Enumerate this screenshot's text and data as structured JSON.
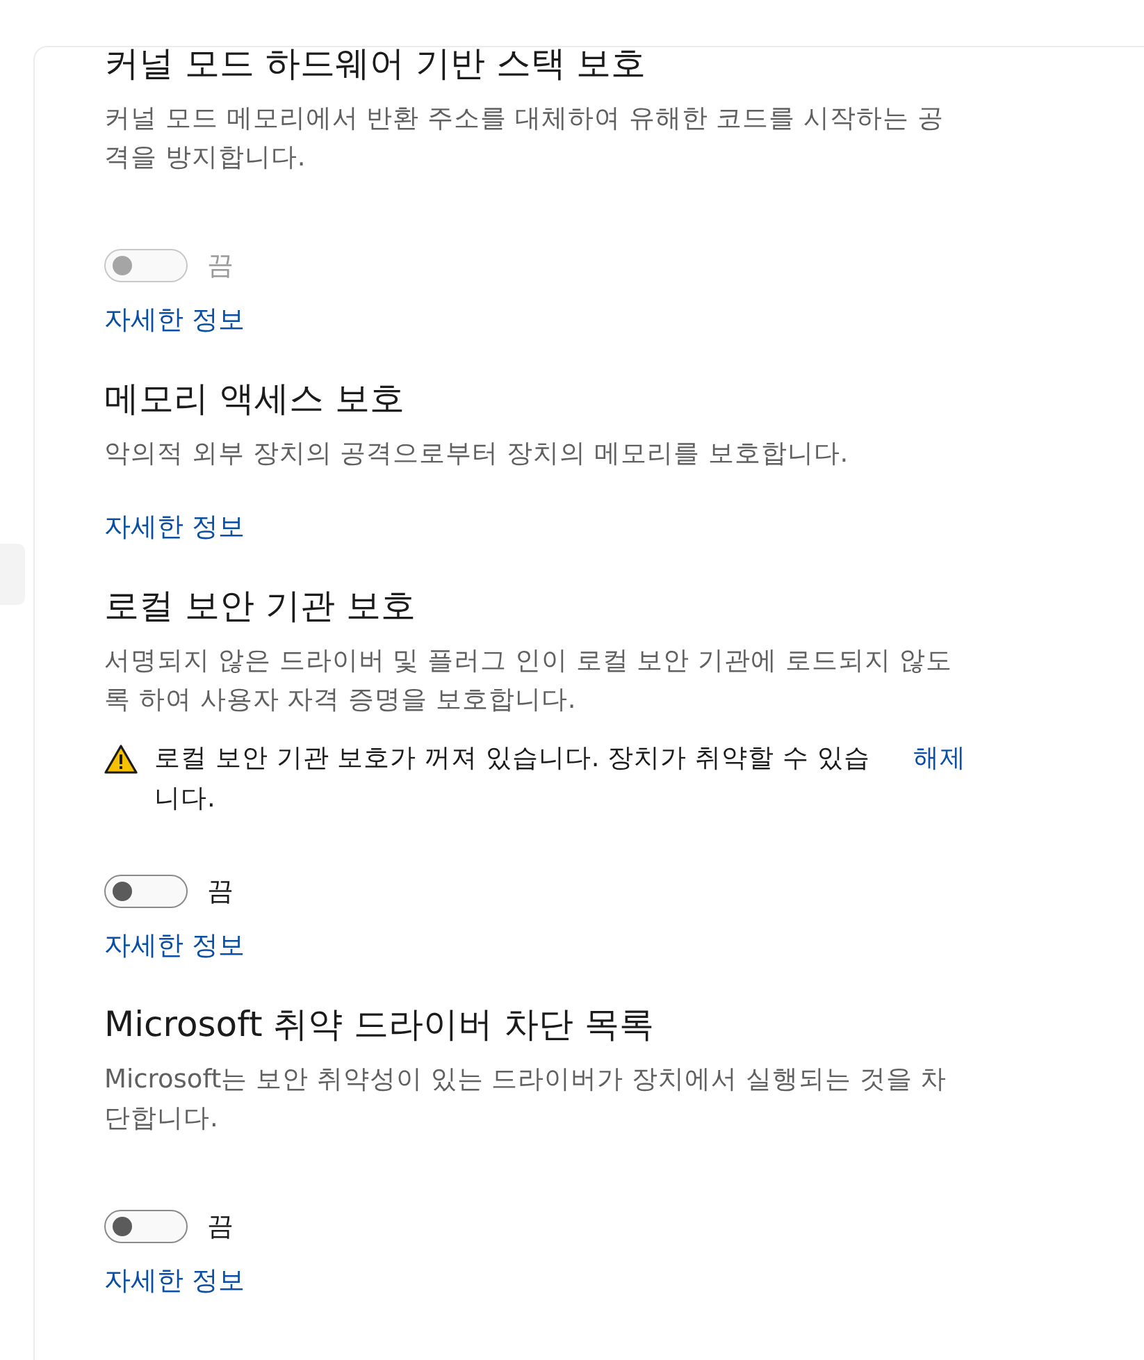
{
  "sections": [
    {
      "title": "커널 모드 하드웨어 기반 스택 보호",
      "description": "커널 모드 메모리에서 반환 주소를 대체하여 유해한 코드를 시작하는 공격을 방지합니다.",
      "toggle": {
        "on": false,
        "disabled": true,
        "label": "끔"
      },
      "link": "자세한 정보"
    },
    {
      "title": "메모리 액세스 보호",
      "description": "악의적  외부 장치의 공격으로부터 장치의 메모리를 보호합니다.",
      "link": "자세한 정보"
    },
    {
      "title": "로컬 보안 기관 보호",
      "description": "서명되지 않은 드라이버 및 플러그 인이 로컬 보안 기관에 로드되지 않도록 하여 사용자 자격 증명을 보호합니다.",
      "warning": {
        "text": "로컬 보안 기관 보호가 꺼져 있습니다. 장치가 취약할 수 있습니다.",
        "action": "해제"
      },
      "toggle": {
        "on": false,
        "disabled": false,
        "label": "끔"
      },
      "link": "자세한 정보"
    },
    {
      "title": "Microsoft 취약 드라이버 차단 목록",
      "description": "Microsoft는 보안 취약성이 있는 드라이버가 장치에서 실행되는 것을 차단합니다.",
      "toggle": {
        "on": false,
        "disabled": false,
        "label": "끔"
      },
      "link": "자세한 정보"
    }
  ]
}
